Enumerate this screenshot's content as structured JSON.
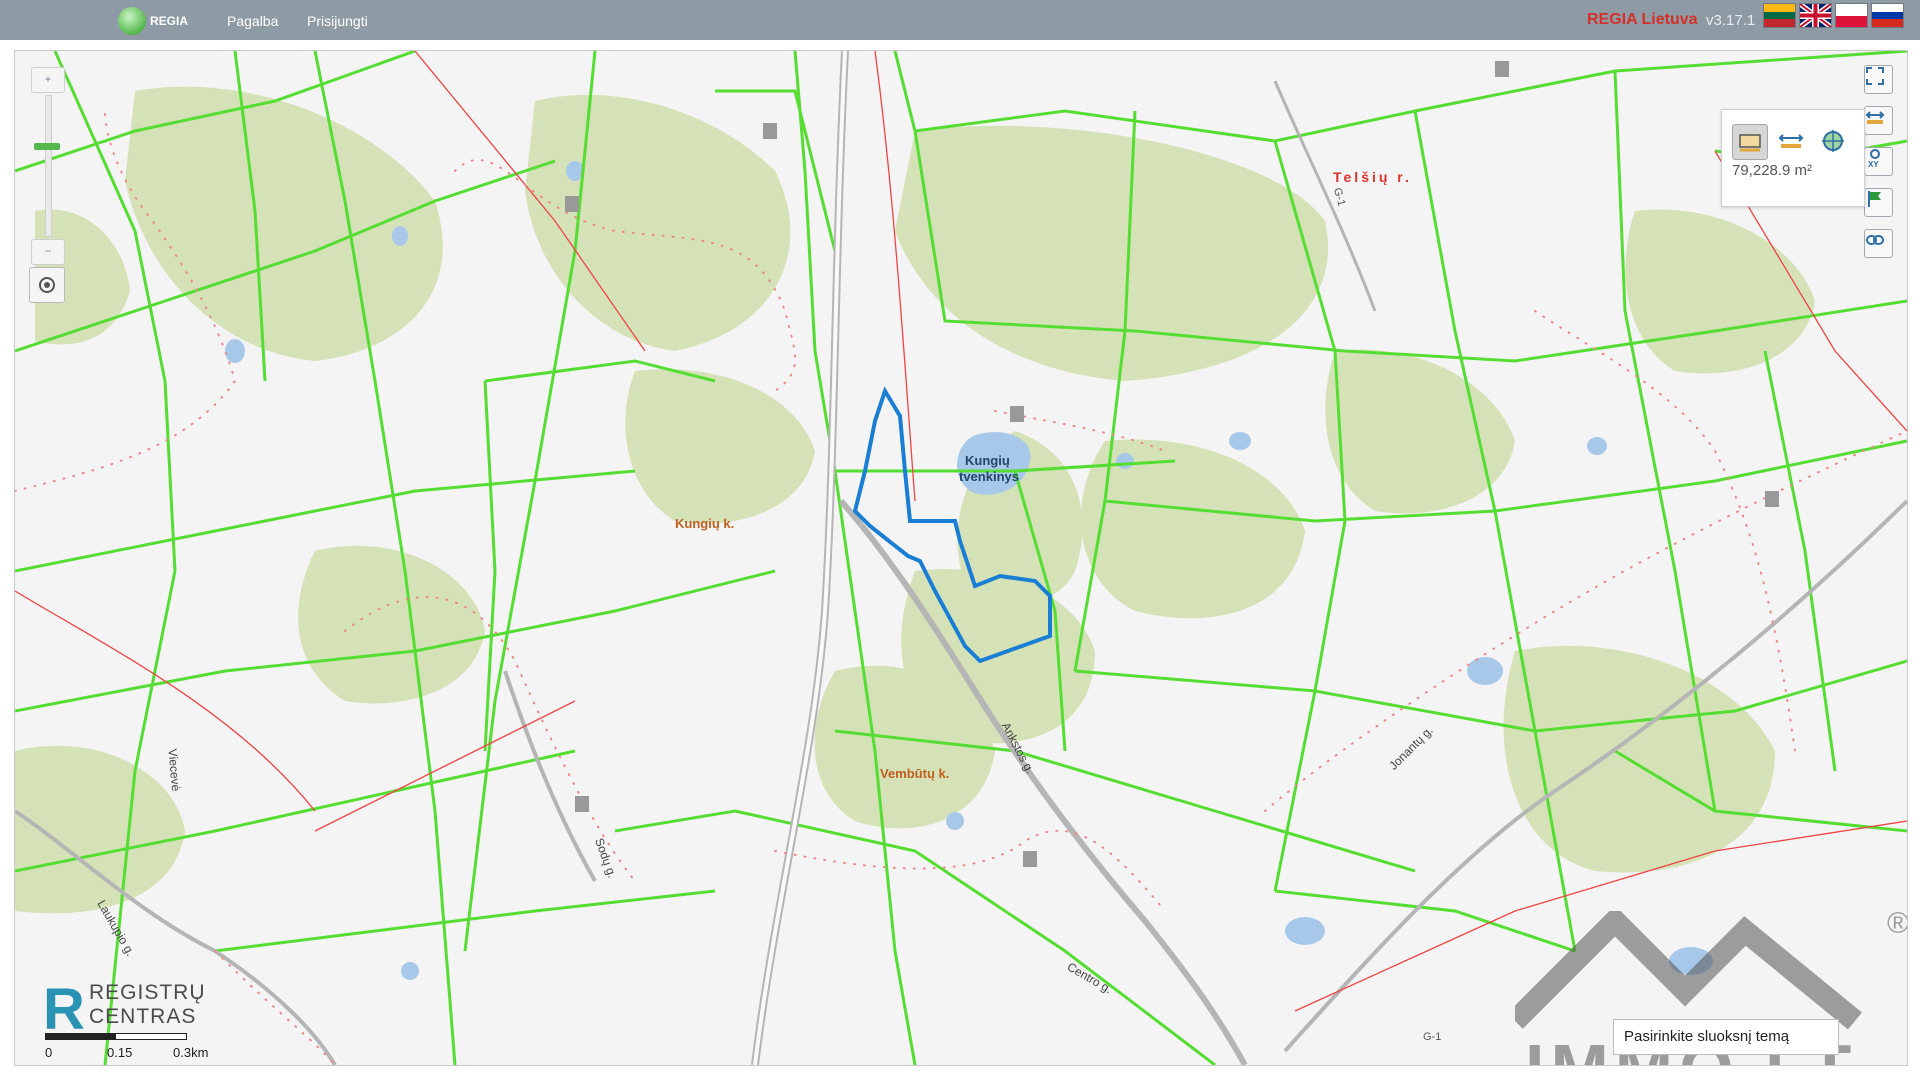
{
  "header": {
    "logo_text": "REGIA",
    "nav": [
      "Pagalba",
      "Prisijungti"
    ],
    "title": "REGIA Lietuva",
    "version": "v3.17.1",
    "languages": [
      {
        "name": "lithuanian-flag",
        "colors": [
          "#fdb913",
          "#006a44",
          "#c1272d"
        ]
      },
      {
        "name": "english-flag",
        "colors": [
          "#012169",
          "#ffffff",
          "#c8102e"
        ]
      },
      {
        "name": "polish-flag",
        "colors": [
          "#ffffff",
          "#dc143c"
        ]
      },
      {
        "name": "russian-flag",
        "colors": [
          "#ffffff",
          "#0039a6",
          "#d52b1e"
        ]
      }
    ]
  },
  "map": {
    "labels": {
      "telsiu": "Telšių r.",
      "kungiu_village": "Kungių k.",
      "pond_line1": "Kungių",
      "pond_line2": "tvenkinys",
      "vembutu": "Vembūtų k.",
      "anykstos": "Ankstos g.",
      "joniskio": "Jonantų g.",
      "laukupio": "Laukupio g.",
      "vilcevo": "Viecevė",
      "g1_top": "G-1",
      "g1_bottom": "G-1",
      "centro": "Centro g.",
      "sodu": "Sodų g."
    },
    "colors": {
      "parcel": "#55dd33",
      "forest": "#d5e2b7",
      "water": "#a8c8ea",
      "power_line": "#ee4444",
      "selection": "#1a7fd4",
      "road": "#b5b5b5"
    },
    "measure": {
      "area": "79,228.9 m²",
      "tools": [
        "area-measure-icon",
        "distance-measure-icon",
        "point-coordinate-icon"
      ]
    },
    "right_tools": [
      "fullscreen-icon",
      "measure-tools-icon",
      "xy-coordinates-icon",
      "flag-icon",
      "link-icon"
    ],
    "zoom": {
      "in": "+",
      "out": "−",
      "level": 0.35
    },
    "scale": {
      "labels": [
        "0",
        "0.15",
        "0.3km"
      ]
    },
    "branding": {
      "registru": "REGISTRŲ",
      "centras": "CENTRAS"
    },
    "layer_select_placeholder": "Pasirinkite sluoksnį temą",
    "watermark": "IMMO.LT",
    "watermark_mark": "®"
  }
}
